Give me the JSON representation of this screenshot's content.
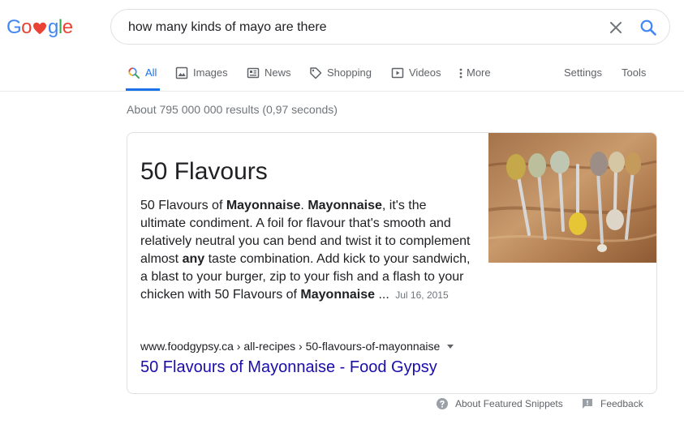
{
  "logo": {
    "letters": [
      "G",
      "o",
      "g",
      "l",
      "e"
    ],
    "colors": [
      "#4285f4",
      "#ea4335",
      "#4285f4",
      "#34a853",
      "#ea4335"
    ],
    "heart_color": "#ea4335"
  },
  "search": {
    "query": "how many kinds of mayo are there"
  },
  "tabs": [
    {
      "label": "All",
      "icon": "search-icon",
      "active": true
    },
    {
      "label": "Images",
      "icon": "image-icon"
    },
    {
      "label": "News",
      "icon": "news-icon"
    },
    {
      "label": "Shopping",
      "icon": "tag-icon"
    },
    {
      "label": "Videos",
      "icon": "video-icon"
    },
    {
      "label": "More",
      "icon": "more-vertical-icon"
    },
    {
      "label": "Settings"
    },
    {
      "label": "Tools"
    }
  ],
  "stats": "About 795 000 000 results (0,97 seconds)",
  "featured": {
    "title": "50 Flavours",
    "body": [
      {
        "text": "50 Flavours of "
      },
      {
        "text": "Mayonnaise",
        "bold": true
      },
      {
        "text": ". "
      },
      {
        "text": "Mayonnaise",
        "bold": true
      },
      {
        "text": ", it's the ultimate condiment. A foil for flavour that's smooth and relatively neutral you can bend and twist it to complement almost "
      },
      {
        "text": "any",
        "bold": true
      },
      {
        "text": " taste combination. Add kick to your sandwich, a blast to your burger, zip to your fish and a flash to your chicken with 50 Flavours of "
      },
      {
        "text": "Mayonnaise",
        "bold": true
      },
      {
        "text": " ..."
      }
    ],
    "date": "Jul 16, 2015",
    "cite": "www.foodgypsy.ca › all-recipes › 50-flavours-of-mayonnaise",
    "link": "50 Flavours of Mayonnaise - Food Gypsy"
  },
  "footer": {
    "about": "About Featured Snippets",
    "feedback": "Feedback"
  },
  "colors": {
    "accent": "#1a73e8",
    "link": "#1a0dab",
    "muted": "#70757a"
  }
}
